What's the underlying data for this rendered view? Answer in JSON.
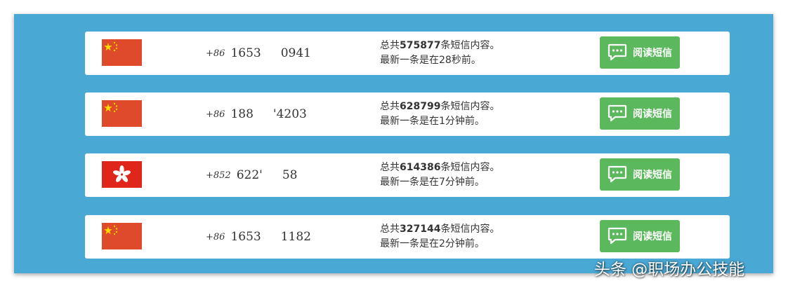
{
  "colors": {
    "background": "#4aa8d5",
    "button": "#5cb85c",
    "china_flag": "#de2910",
    "hk_flag": "#de2910"
  },
  "rows": [
    {
      "flag": "china-flag-icon",
      "code": "+86",
      "num_a": "1653",
      "num_b": "0941",
      "total_prefix": "总共",
      "total_count": "575877",
      "total_suffix": "条短信内容。",
      "latest": "最新一条是在28秒前。",
      "button_label": "阅读短信"
    },
    {
      "flag": "china-flag-icon",
      "code": "+86",
      "num_a": "188",
      "num_b": "'4203",
      "total_prefix": "总共",
      "total_count": "628799",
      "total_suffix": "条短信内容。",
      "latest": "最新一条是在1分钟前。",
      "button_label": "阅读短信"
    },
    {
      "flag": "hongkong-flag-icon",
      "code": "+852",
      "num_a": "622'",
      "num_b": "58",
      "total_prefix": "总共",
      "total_count": "614386",
      "total_suffix": "条短信内容。",
      "latest": "最新一条是在7分钟前。",
      "button_label": "阅读短信"
    },
    {
      "flag": "china-flag-icon",
      "code": "+86",
      "num_a": "1653",
      "num_b": "1182",
      "total_prefix": "总共",
      "total_count": "327144",
      "total_suffix": "条短信内容。",
      "latest": "最新一条是在2分钟前。",
      "button_label": "阅读短信"
    }
  ],
  "watermark": "头条 @职场办公技能"
}
